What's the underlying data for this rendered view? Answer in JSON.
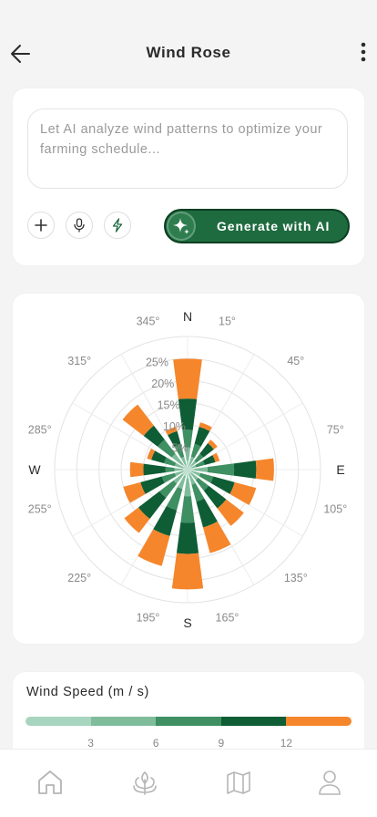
{
  "header": {
    "title": "Wind Rose",
    "back_icon": "arrow-left-icon",
    "menu_icon": "more-vertical-icon"
  },
  "ai_panel": {
    "placeholder": "Let AI analyze wind patterns to optimize your farming schedule...",
    "tools": [
      "plus-icon",
      "microphone-icon",
      "lightning-icon"
    ],
    "generate_label": "Generate with AI",
    "generate_icon": "sparkle-icon"
  },
  "chart_data": {
    "type": "polar-stacked-bar",
    "title": "",
    "cardinals": [
      "N",
      "E",
      "S",
      "W"
    ],
    "angle_labels": [
      "15°",
      "45°",
      "75°",
      "105°",
      "135°",
      "165°",
      "195°",
      "225°",
      "255°",
      "285°",
      "315°",
      "345°"
    ],
    "radial_ticks": [
      "5%",
      "10%",
      "15%",
      "20%",
      "25%"
    ],
    "rmax": 30,
    "directions": [
      0,
      22.5,
      45,
      67.5,
      90,
      112.5,
      135,
      157.5,
      180,
      202.5,
      225,
      247.5,
      270,
      292.5,
      315,
      337.5
    ],
    "series": [
      {
        "name": "0-3",
        "color": "#a8d5bf",
        "values": [
          2,
          1,
          1,
          1,
          1.5,
          1,
          1,
          1,
          2,
          1.5,
          1.5,
          1,
          1,
          1,
          1.5,
          1
        ]
      },
      {
        "name": "3-6",
        "color": "#7fbc9b",
        "values": [
          3,
          2,
          1.5,
          1,
          3,
          2,
          2,
          2.5,
          4,
          3,
          2.5,
          2,
          2,
          2,
          3,
          2
        ]
      },
      {
        "name": "6-9",
        "color": "#3e8f62",
        "values": [
          4,
          3,
          2,
          2,
          6,
          3,
          3,
          4,
          6,
          5,
          4,
          3,
          2,
          2.5,
          4,
          3
        ]
      },
      {
        "name": "9-12",
        "color": "#0e5d34",
        "values": [
          7,
          4,
          3,
          2.5,
          5,
          5,
          5,
          6,
          7,
          6,
          6,
          5,
          5,
          3,
          4,
          3
        ]
      },
      {
        "name": "12+",
        "color": "#f5862b",
        "values": [
          9,
          1,
          1,
          1,
          4,
          5,
          5,
          6,
          8,
          7,
          4,
          4,
          3,
          1,
          6,
          1
        ]
      }
    ]
  },
  "wind_speed": {
    "title": "Wind Speed (m / s)",
    "colors": [
      "#a8d5bf",
      "#7fbc9b",
      "#3e8f62",
      "#0e5d34",
      "#f5862b"
    ],
    "ticks": [
      "3",
      "6",
      "9",
      "12"
    ]
  },
  "nav": {
    "items": [
      "home-icon",
      "crops-icon",
      "map-icon",
      "profile-icon"
    ]
  }
}
